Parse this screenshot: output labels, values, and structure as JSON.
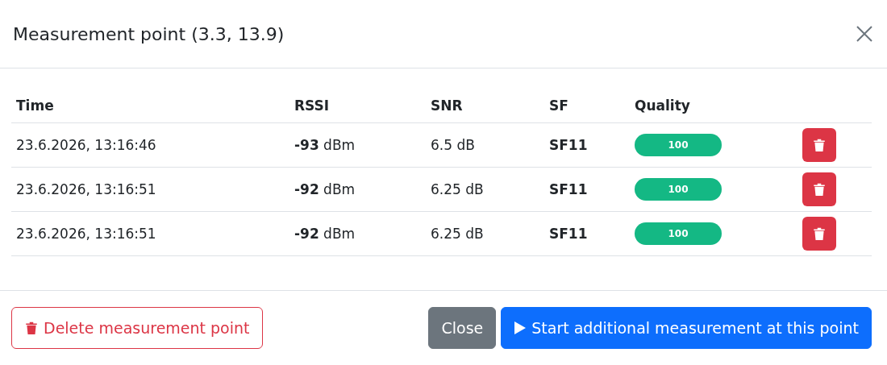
{
  "dialog": {
    "title": "Measurement point (3.3, 13.9)"
  },
  "table": {
    "columns": [
      "Time",
      "RSSI",
      "SNR",
      "SF",
      "Quality"
    ],
    "rows": [
      {
        "time": "23.6.2026, 13:16:46",
        "rssi": "**-93** dBm",
        "snr": "6.5 dB",
        "sf": "SF11",
        "quality": {
          "level": 1,
          "label": "100"
        }
      },
      {
        "time": "23.6.2026, 13:16:51",
        "rssi": "**-92** dBm",
        "snr": "6.25 dB",
        "sf": "SF11",
        "quality": {
          "level": 1,
          "label": "100"
        }
      },
      {
        "time": "23.6.2026, 13:16:51",
        "rssi": "**-92** dBm",
        "snr": "6.25 dB",
        "sf": "SF11",
        "quality": {
          "level": 1,
          "label": "100"
        }
      }
    ]
  },
  "footer": {
    "buttons": [
      {
        "kind": "outline-danger",
        "label": "Delete measurement point"
      },
      {
        "kind": "secondary",
        "label": "Close"
      },
      {
        "kind": "primary",
        "label": "Start additional measurement at this point"
      }
    ]
  }
}
